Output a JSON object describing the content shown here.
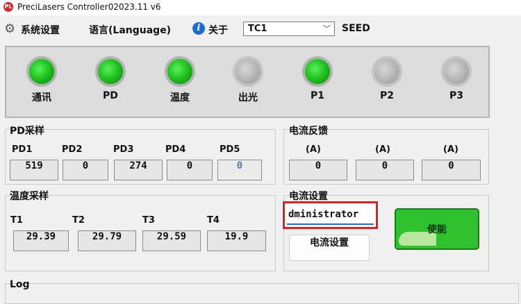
{
  "window": {
    "title": "PreciLasers Controller02023.11 v6",
    "app_icon_text": "PL"
  },
  "menubar": {
    "settings_label": "系统设置",
    "language_label": "语言(Language)",
    "about_label": "关于",
    "device_select": "TC1",
    "seed_label": "SEED"
  },
  "indicators": [
    {
      "label": "通讯",
      "state": "on"
    },
    {
      "label": "PD",
      "state": "on"
    },
    {
      "label": "温度",
      "state": "on"
    },
    {
      "label": "出光",
      "state": "off"
    },
    {
      "label": "P1",
      "state": "on"
    },
    {
      "label": "P2",
      "state": "off"
    },
    {
      "label": "P3",
      "state": "off"
    }
  ],
  "pd_sampling": {
    "title": "PD采样",
    "labels": [
      "PD1",
      "PD2",
      "PD3",
      "PD4",
      "PD5"
    ],
    "values": [
      "519",
      "0",
      "274",
      "0",
      "0"
    ]
  },
  "current_feedback": {
    "title": "电流反馈",
    "units": [
      "(A)",
      "(A)",
      "(A)"
    ],
    "values": [
      "0",
      "0",
      "0"
    ]
  },
  "temp_sampling": {
    "title": "温度采样",
    "labels": [
      "T1",
      "T2",
      "T3",
      "T4"
    ],
    "values": [
      "29.39",
      "29.79",
      "29.59",
      "19.9"
    ]
  },
  "current_setting": {
    "title": "电流设置",
    "input_value": "dministrator",
    "set_button": "电流设置",
    "enable_button": "使能"
  },
  "log": {
    "title": "Log"
  },
  "colors": {
    "led_on": "#22c422",
    "led_off": "#b3b3b3",
    "highlight_border": "#e02020",
    "enable_button": "#2ec22e"
  }
}
